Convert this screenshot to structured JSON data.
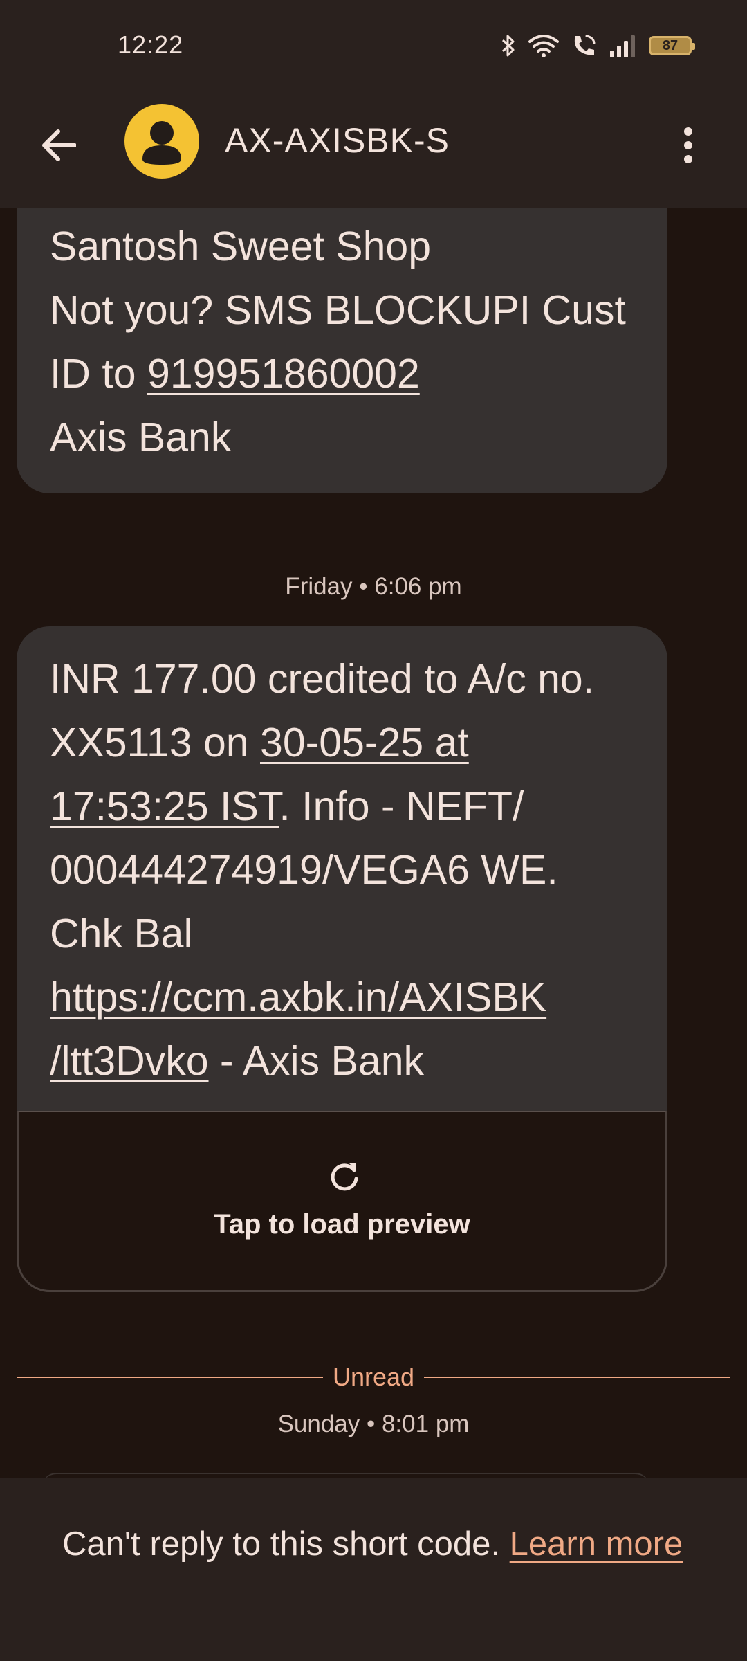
{
  "status_bar": {
    "time": "12:22",
    "battery_level": "87"
  },
  "app_bar": {
    "contact_name": "AX-AXISBK-S"
  },
  "messages": {
    "top_bubble_lines": [
      "Santosh Sweet Shop",
      "Not you? SMS BLOCKUPI Cust",
      "ID to ",
      "Axis Bank"
    ],
    "top_bubble_link": "919951860002",
    "timestamp_1": "Friday • 6:06 pm",
    "main": {
      "line1": "INR 177.00 credited to A/c no.",
      "line2_prefix": "XX5113 on ",
      "line2_link": "30-05-25 at",
      "line3_link": "17:53:25 IST",
      "line3_suffix": ". Info - NEFT/",
      "line4": "000444274919/VEGA6 WE.",
      "line5": "Chk Bal",
      "line6_link": "https://ccm.axbk.in/AXISBK",
      "line7_link": "/ltt3Dvko",
      "line7_suffix": " - Axis Bank"
    },
    "preview_label": "Tap to load preview",
    "unread_label": "Unread",
    "timestamp_2": "Sunday • 8:01 pm"
  },
  "banner": {
    "text": "Can't reply to this short code. ",
    "link": "Learn more"
  },
  "colors": {
    "background": "#1f140f",
    "bubble": "#363130",
    "accent": "#f0a985",
    "avatar": "#f4c233"
  }
}
